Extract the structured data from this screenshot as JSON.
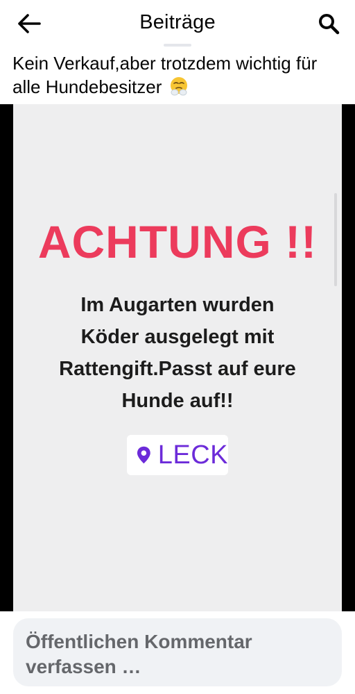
{
  "header": {
    "title": "Beiträge",
    "back_icon": "arrow-left-icon",
    "search_icon": "search-icon"
  },
  "post": {
    "caption": "Kein Verkauf,aber trotzdem wichtig für alle Hundebesitzer",
    "caption_emoji": "face-with-steam-from-nose-emoji",
    "image": {
      "headline": "ACHTUNG !!",
      "message": "Im Augarten wurden Köder ausgelegt mit Rattengift.Passt auf eure Hunde auf!!",
      "location_sticker": "LECK",
      "location_icon": "location-pin-icon",
      "colors": {
        "headline": "#ec3b5c",
        "location": "#6c2bd9",
        "background": "#eeeeef"
      }
    }
  },
  "comment": {
    "placeholder": "Öffentlichen Kommentar verfassen …"
  }
}
